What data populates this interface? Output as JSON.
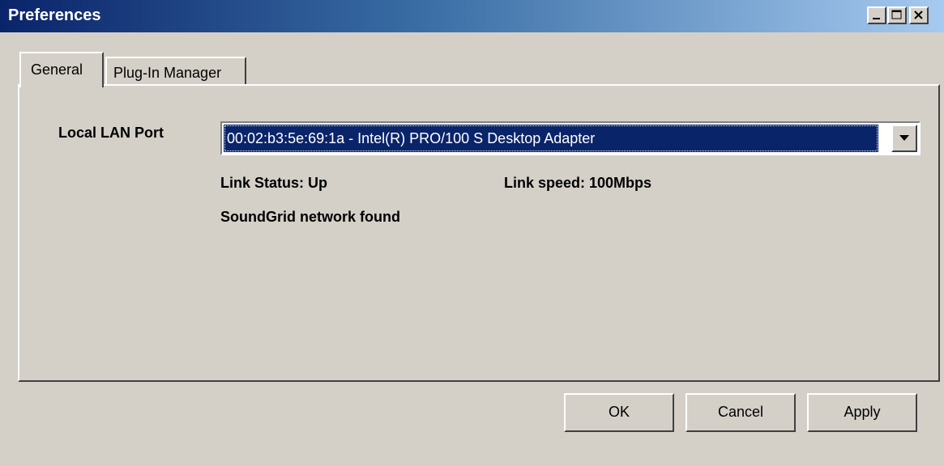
{
  "window": {
    "title": "Preferences",
    "controls": [
      "minimize-icon",
      "maximize-icon",
      "close-icon"
    ]
  },
  "tabs": [
    {
      "label": "General",
      "selected": true
    },
    {
      "label": "Plug-In Manager",
      "selected": false
    }
  ],
  "general": {
    "lan_port_label": "Local LAN Port",
    "lan_port_value": "00:02:b3:5e:69:1a - Intel(R) PRO/100 S Desktop Adapter",
    "link_status": "Link Status: Up",
    "link_speed": "Link speed: 100Mbps",
    "network_status": "SoundGrid network found"
  },
  "buttons": {
    "ok": "OK",
    "cancel": "Cancel",
    "apply": "Apply"
  },
  "colors": {
    "titlebar_start": "#0a246a",
    "titlebar_end": "#a6caf0",
    "selection": "#0a246a",
    "face": "#d4d0c8"
  }
}
